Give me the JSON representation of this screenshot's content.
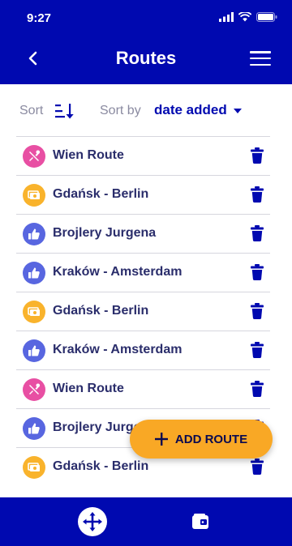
{
  "status_bar": {
    "time": "9:27"
  },
  "header": {
    "title": "Routes"
  },
  "sort": {
    "sort_label": "Sort",
    "sort_by_label": "Sort by",
    "selected": "date added"
  },
  "routes": [
    {
      "name": "Wien Route",
      "icon": "tools-icon",
      "color": "#e84fa3"
    },
    {
      "name": "Gdańsk - Berlin",
      "icon": "money-icon",
      "color": "#f9b32c"
    },
    {
      "name": "Brojlery Jurgena",
      "icon": "thumbs-up-icon",
      "color": "#5866e0"
    },
    {
      "name": "Kraków - Amsterdam",
      "icon": "thumbs-up-icon",
      "color": "#5866e0"
    },
    {
      "name": "Gdańsk - Berlin",
      "icon": "money-icon",
      "color": "#f9b32c"
    },
    {
      "name": "Kraków - Amsterdam",
      "icon": "thumbs-up-icon",
      "color": "#5866e0"
    },
    {
      "name": "Wien Route",
      "icon": "tools-icon",
      "color": "#e84fa3"
    },
    {
      "name": "Brojlery Jurgena",
      "icon": "thumbs-up-icon",
      "color": "#5866e0"
    },
    {
      "name": "Gdańsk - Berlin",
      "icon": "money-icon",
      "color": "#f9b32c"
    }
  ],
  "fab": {
    "label": "ADD ROUTE"
  },
  "colors": {
    "primary": "#0009b0",
    "accent": "#f9a825",
    "text": "#2a2d6b",
    "muted": "#8a8aa0"
  }
}
